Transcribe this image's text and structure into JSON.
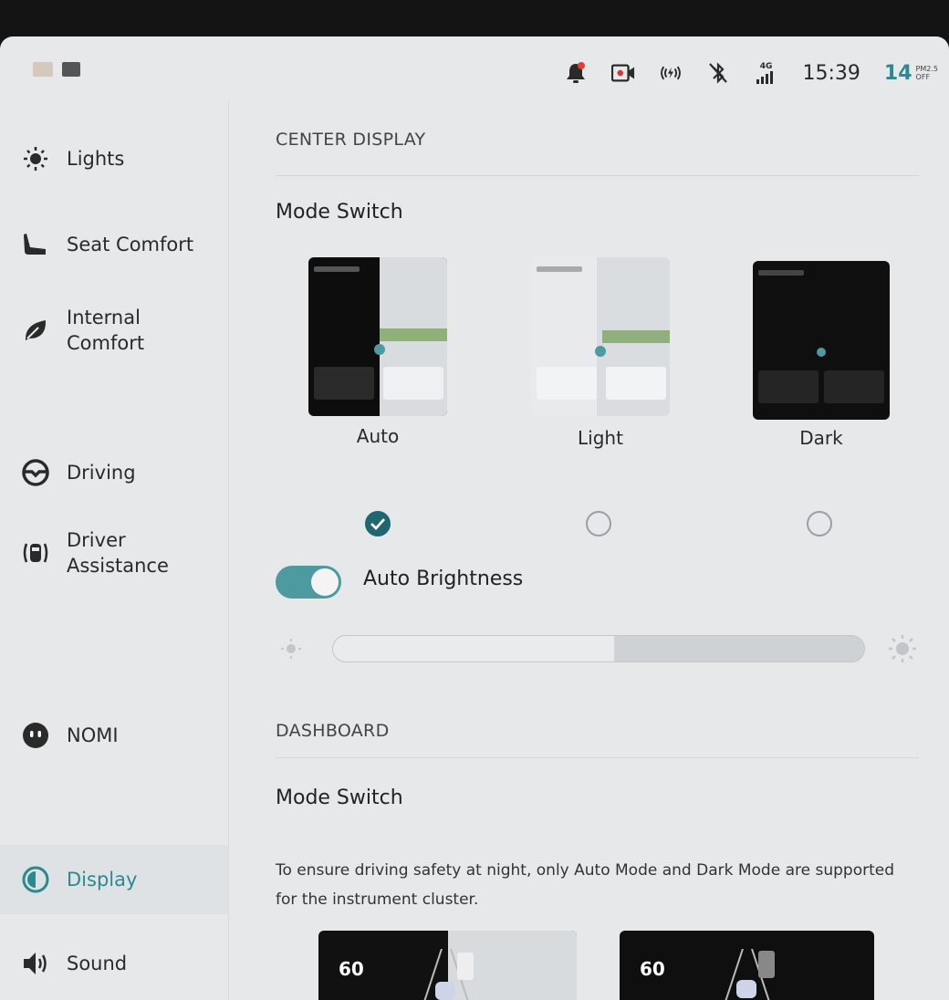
{
  "status_bar": {
    "time": "15:39",
    "pm_value": "14",
    "pm_label_top": "PM2.5",
    "pm_label_bottom": "OFF",
    "network": "4G",
    "icons": [
      "bell-icon",
      "dashcam-icon",
      "hotspot-icon",
      "bluetooth-off-icon",
      "signal-icon"
    ]
  },
  "sidebar": {
    "items": [
      {
        "label": "Lights",
        "icon": "light-icon"
      },
      {
        "label": "Seat Comfort",
        "icon": "seat-icon"
      },
      {
        "label": "Internal\nComfort",
        "icon": "leaf-icon"
      },
      {
        "label": "Driving",
        "icon": "steering-wheel-icon"
      },
      {
        "label": "Driver\nAssistance",
        "icon": "driver-assist-icon"
      },
      {
        "label": "NOMI",
        "icon": "nomi-icon"
      },
      {
        "label": "Display",
        "icon": "display-icon",
        "active": true
      },
      {
        "label": "Sound",
        "icon": "speaker-icon"
      }
    ]
  },
  "center_display": {
    "section_title": "CENTER DISPLAY",
    "mode_heading": "Mode Switch",
    "modes": [
      {
        "label": "Auto",
        "selected": true
      },
      {
        "label": "Light",
        "selected": false
      },
      {
        "label": "Dark",
        "selected": false
      }
    ],
    "auto_brightness": {
      "label": "Auto Brightness",
      "enabled": true
    },
    "brightness_level": 0.53
  },
  "dashboard": {
    "section_title": "DASHBOARD",
    "mode_heading": "Mode Switch",
    "description": "To ensure driving safety at night, only Auto Mode and Dark Mode are supported for the instrument cluster.",
    "speed_auto": "60",
    "speed_dark": "60"
  },
  "colors": {
    "accent": "#2b8a8f",
    "toggle_on": "#4d9aa1",
    "check_fill": "#1f6670",
    "background": "#e6e8ea"
  }
}
